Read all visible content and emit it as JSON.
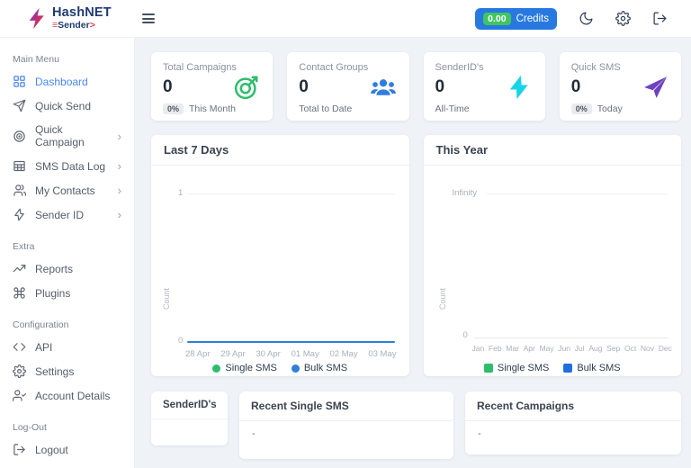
{
  "app": {
    "brand_line1": "HashNET",
    "brand_line2_prefix": "≡",
    "brand_line2": "Sender",
    "brand_line2_suffix": ">"
  },
  "header": {
    "credits_amount": "0.00",
    "credits_label": "Credits",
    "icons": [
      "moon-icon",
      "gear-icon",
      "logout-icon"
    ],
    "accent_blue": "#2779e0",
    "accent_green": "#41c464"
  },
  "sidebar": {
    "sections": [
      {
        "title": "Main Menu",
        "items": [
          {
            "label": "Dashboard",
            "icon": "grid-icon",
            "active": true
          },
          {
            "label": "Quick Send",
            "icon": "send-icon"
          },
          {
            "label": "Quick Campaign",
            "icon": "target-icon",
            "chevron": "›"
          },
          {
            "label": "SMS Data Log",
            "icon": "table-icon",
            "chevron": "›"
          },
          {
            "label": "My Contacts",
            "icon": "users-icon",
            "chevron": "›"
          },
          {
            "label": "Sender ID",
            "icon": "bolt-icon",
            "chevron": "›"
          }
        ]
      },
      {
        "title": "Extra",
        "items": [
          {
            "label": "Reports",
            "icon": "trending-up-icon"
          },
          {
            "label": "Plugins",
            "icon": "command-icon"
          }
        ]
      },
      {
        "title": "Configuration",
        "items": [
          {
            "label": "API",
            "icon": "code-icon"
          },
          {
            "label": "Settings",
            "icon": "gear-icon"
          },
          {
            "label": "Account Details",
            "icon": "user-check-icon"
          }
        ]
      },
      {
        "title": "Log-Out",
        "items": [
          {
            "label": "Logout",
            "icon": "logout-icon"
          }
        ]
      }
    ]
  },
  "stats": [
    {
      "title": "Total Campaigns",
      "value": "0",
      "badge": "0%",
      "subtitle": "This Month",
      "icon": "target-dart-icon",
      "accent": "#2ebd6b"
    },
    {
      "title": "Contact Groups",
      "value": "0",
      "subtitle": "Total to Date",
      "icon": "users-group-icon",
      "accent": "#2f7de1"
    },
    {
      "title": "SenderID's",
      "value": "0",
      "subtitle": "All-Time",
      "icon": "lightning-icon",
      "accent": "#19d3e8"
    },
    {
      "title": "Quick SMS",
      "value": "0",
      "badge": "0%",
      "subtitle": "Today",
      "icon": "paper-plane-icon",
      "accent": "#6f42c1"
    }
  ],
  "chart_data": [
    {
      "type": "line",
      "title": "Last 7 Days",
      "xlabel": "",
      "ylabel": "Count",
      "x": [
        "28 Apr",
        "29 Apr",
        "30 Apr",
        "01 May",
        "02 May",
        "03 May"
      ],
      "yticks_shown": [
        "1",
        "0"
      ],
      "ylim": [
        0,
        1
      ],
      "grid": "top-gridline-only",
      "legend_position": "bottom",
      "series": [
        {
          "name": "Single SMS",
          "color": "#2ebd6b",
          "marker": "circle",
          "values": [
            0,
            0,
            0,
            0,
            0,
            0
          ]
        },
        {
          "name": "Bulk SMS",
          "color": "#2f7ed8",
          "marker": "circle",
          "values": [
            0,
            0,
            0,
            0,
            0,
            0
          ]
        }
      ]
    },
    {
      "type": "bar",
      "title": "This Year",
      "xlabel": "",
      "ylabel": "Count",
      "x": [
        "Jan",
        "Feb",
        "Mar",
        "Apr",
        "May",
        "Jun",
        "Jul",
        "Aug",
        "Sep",
        "Oct",
        "Nov",
        "Dec"
      ],
      "yticks_shown": [
        "Infinity",
        "0"
      ],
      "grid": "top-gridline-only",
      "legend_position": "bottom",
      "series": [
        {
          "name": "Single SMS",
          "color": "#2ebd6b",
          "marker": "square",
          "values": [
            0,
            0,
            0,
            0,
            0,
            0,
            0,
            0,
            0,
            0,
            0,
            0
          ]
        },
        {
          "name": "Bulk SMS",
          "color": "#1f6fe0",
          "marker": "square",
          "values": [
            0,
            0,
            0,
            0,
            0,
            0,
            0,
            0,
            0,
            0,
            0,
            0
          ]
        }
      ]
    }
  ],
  "panels": [
    {
      "title": "SenderID's",
      "body": ""
    },
    {
      "title": "Recent Single SMS",
      "body": "-"
    },
    {
      "title": "Recent Campaigns",
      "body": "-"
    }
  ]
}
